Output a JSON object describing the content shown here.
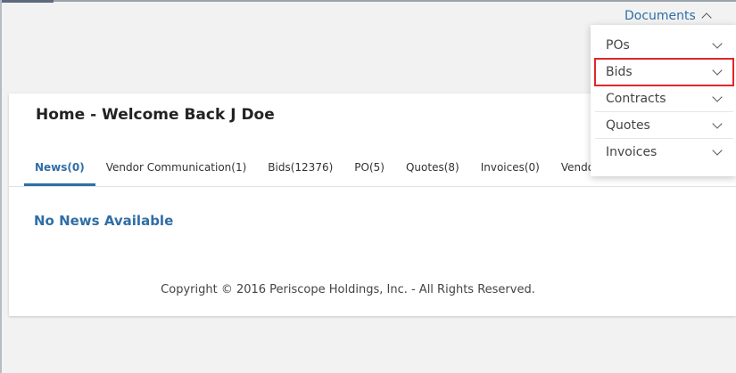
{
  "top_nav": {
    "documents_label": "Documents"
  },
  "page": {
    "title": "Home - Welcome Back J Doe"
  },
  "tabs": [
    {
      "label": "News(0)",
      "active": true
    },
    {
      "label": "Vendor Communication(1)"
    },
    {
      "label": "Bids(12376)"
    },
    {
      "label": "PO(5)"
    },
    {
      "label": "Quotes(8)"
    },
    {
      "label": "Invoices(0)"
    },
    {
      "label": "Vendor"
    }
  ],
  "content": {
    "no_news": "No News Available"
  },
  "footer": {
    "copyright": "Copyright © 2016 Periscope Holdings, Inc. - All Rights Reserved."
  },
  "documents_menu": {
    "items": [
      {
        "label": "POs"
      },
      {
        "label": "Bids",
        "highlighted": true
      },
      {
        "label": "Contracts"
      },
      {
        "label": "Quotes"
      },
      {
        "label": "Invoices"
      }
    ]
  },
  "colors": {
    "accent": "#2f6ea6",
    "highlight_border": "#e0262b"
  },
  "icons": {
    "documents_toggle": "chevron-up-icon",
    "menu_item_expand": "chevron-down-icon"
  }
}
